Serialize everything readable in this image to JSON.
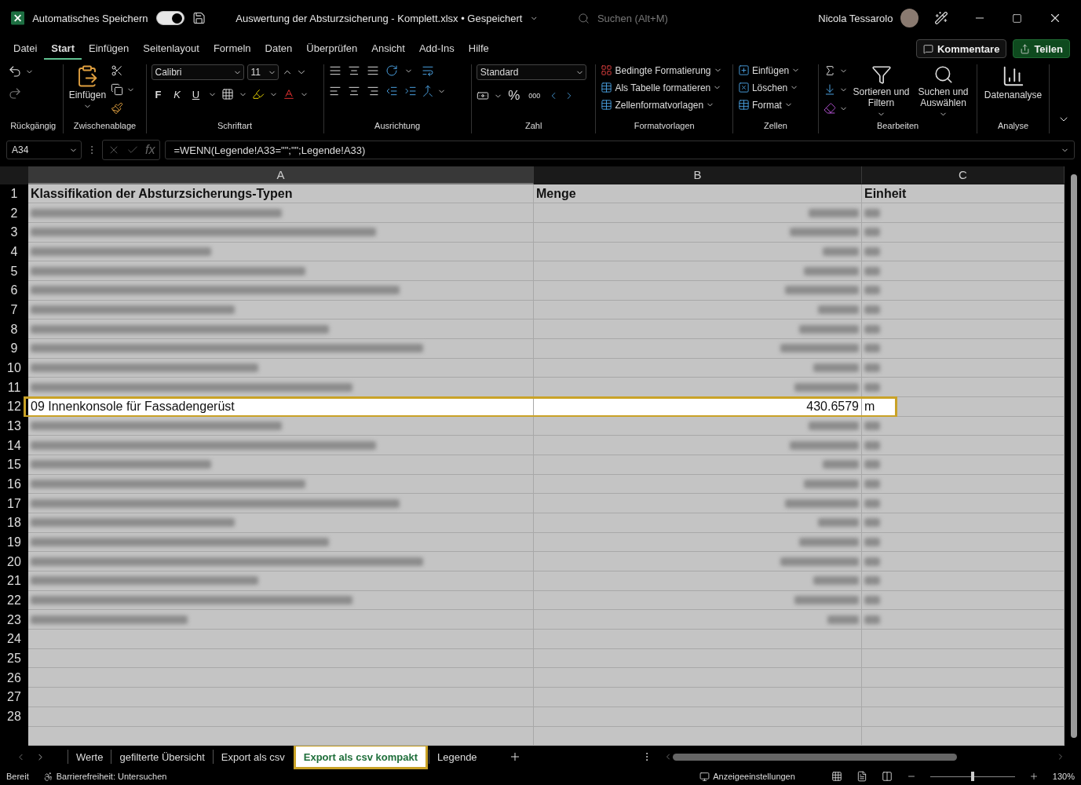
{
  "title_bar": {
    "autosave_label": "Automatisches Speichern",
    "autosave_on": true,
    "document_title": "Auswertung der Absturzsicherung - Komplett.xlsx • Gespeichert",
    "search_placeholder": "Suchen (Alt+M)",
    "user_name": "Nicola Tessarolo"
  },
  "menu_tabs": [
    {
      "label": "Datei",
      "selected": false
    },
    {
      "label": "Start",
      "selected": true
    },
    {
      "label": "Einfügen",
      "selected": false
    },
    {
      "label": "Seitenlayout",
      "selected": false
    },
    {
      "label": "Formeln",
      "selected": false
    },
    {
      "label": "Daten",
      "selected": false
    },
    {
      "label": "Überprüfen",
      "selected": false
    },
    {
      "label": "Ansicht",
      "selected": false
    },
    {
      "label": "Add-Ins",
      "selected": false
    },
    {
      "label": "Hilfe",
      "selected": false
    }
  ],
  "actions": {
    "comments": "Kommentare",
    "share": "Teilen"
  },
  "ribbon": {
    "groups": [
      {
        "kind": "undo",
        "label": "Rückgängig"
      },
      {
        "kind": "clipboard",
        "label": "Zwischenablage",
        "paste": "Einfügen"
      },
      {
        "kind": "font",
        "label": "Schriftart",
        "font": "Calibri",
        "size": "11",
        "bold": "F",
        "italic": "K",
        "underline": "U"
      },
      {
        "kind": "alignment",
        "label": "Ausrichtung"
      },
      {
        "kind": "number",
        "label": "Zahl",
        "format": "Standard",
        "percent": "%",
        "thousands": "000"
      },
      {
        "kind": "styles",
        "label": "Formatvorlagen",
        "items": [
          "Bedingte Formatierung",
          "Als Tabelle formatieren",
          "Zellenformatvorlagen"
        ]
      },
      {
        "kind": "cells",
        "label": "Zellen",
        "items": [
          "Einfügen",
          "Löschen",
          "Format"
        ]
      },
      {
        "kind": "editing",
        "label": "Bearbeiten",
        "items": [
          "Sortieren und Filtern",
          "Suchen und Auswählen"
        ]
      },
      {
        "kind": "analysis",
        "label": "Analyse",
        "items": [
          "Datenanalyse"
        ]
      }
    ]
  },
  "formula_bar": {
    "name_box": "A34",
    "fx": "fx",
    "formula": "=WENN(Legende!A33=\"\";\"\";Legende!A33)"
  },
  "columns": [
    {
      "label": "A",
      "selected": true
    },
    {
      "label": "B",
      "selected": false
    },
    {
      "label": "C",
      "selected": false
    }
  ],
  "rows": [
    {
      "number": "1",
      "kind": "header",
      "cells": [
        "Klassifikation der Absturzsicherungs-Typen",
        "Menge",
        "Einheit"
      ]
    },
    {
      "number": "2",
      "kind": "blurred"
    },
    {
      "number": "3",
      "kind": "blurred"
    },
    {
      "number": "4",
      "kind": "blurred"
    },
    {
      "number": "5",
      "kind": "blurred"
    },
    {
      "number": "6",
      "kind": "blurred"
    },
    {
      "number": "7",
      "kind": "blurred"
    },
    {
      "number": "8",
      "kind": "blurred"
    },
    {
      "number": "9",
      "kind": "blurred"
    },
    {
      "number": "10",
      "kind": "blurred"
    },
    {
      "number": "11",
      "kind": "blurred"
    },
    {
      "number": "12",
      "kind": "highlighted",
      "cells": [
        "09 Innenkonsole für Fassadengerüst",
        "430.6579",
        "m"
      ]
    },
    {
      "number": "13",
      "kind": "blurred"
    },
    {
      "number": "14",
      "kind": "blurred"
    },
    {
      "number": "15",
      "kind": "blurred"
    },
    {
      "number": "16",
      "kind": "blurred"
    },
    {
      "number": "17",
      "kind": "blurred"
    },
    {
      "number": "18",
      "kind": "blurred"
    },
    {
      "number": "19",
      "kind": "blurred"
    },
    {
      "number": "20",
      "kind": "blurred"
    },
    {
      "number": "21",
      "kind": "blurred"
    },
    {
      "number": "22",
      "kind": "blurred"
    },
    {
      "number": "23",
      "kind": "blurred"
    },
    {
      "number": "24",
      "kind": "empty"
    },
    {
      "number": "25",
      "kind": "empty"
    },
    {
      "number": "26",
      "kind": "empty"
    },
    {
      "number": "27",
      "kind": "empty"
    },
    {
      "number": "28",
      "kind": "empty"
    }
  ],
  "sheet_tabs": [
    {
      "label": "Werte",
      "selected": false
    },
    {
      "label": "gefilterte Übersicht",
      "selected": false
    },
    {
      "label": "Export als csv",
      "selected": false
    },
    {
      "label": "Export als csv kompakt",
      "selected": true
    },
    {
      "label": "Legende",
      "selected": false
    }
  ],
  "status_bar": {
    "ready": "Bereit",
    "accessibility": "Barrierefreiheit: Untersuchen",
    "display_settings": "Anzeigeeinstellungen",
    "zoom": "130%"
  },
  "zoom_slider": {
    "level": 0.5
  }
}
